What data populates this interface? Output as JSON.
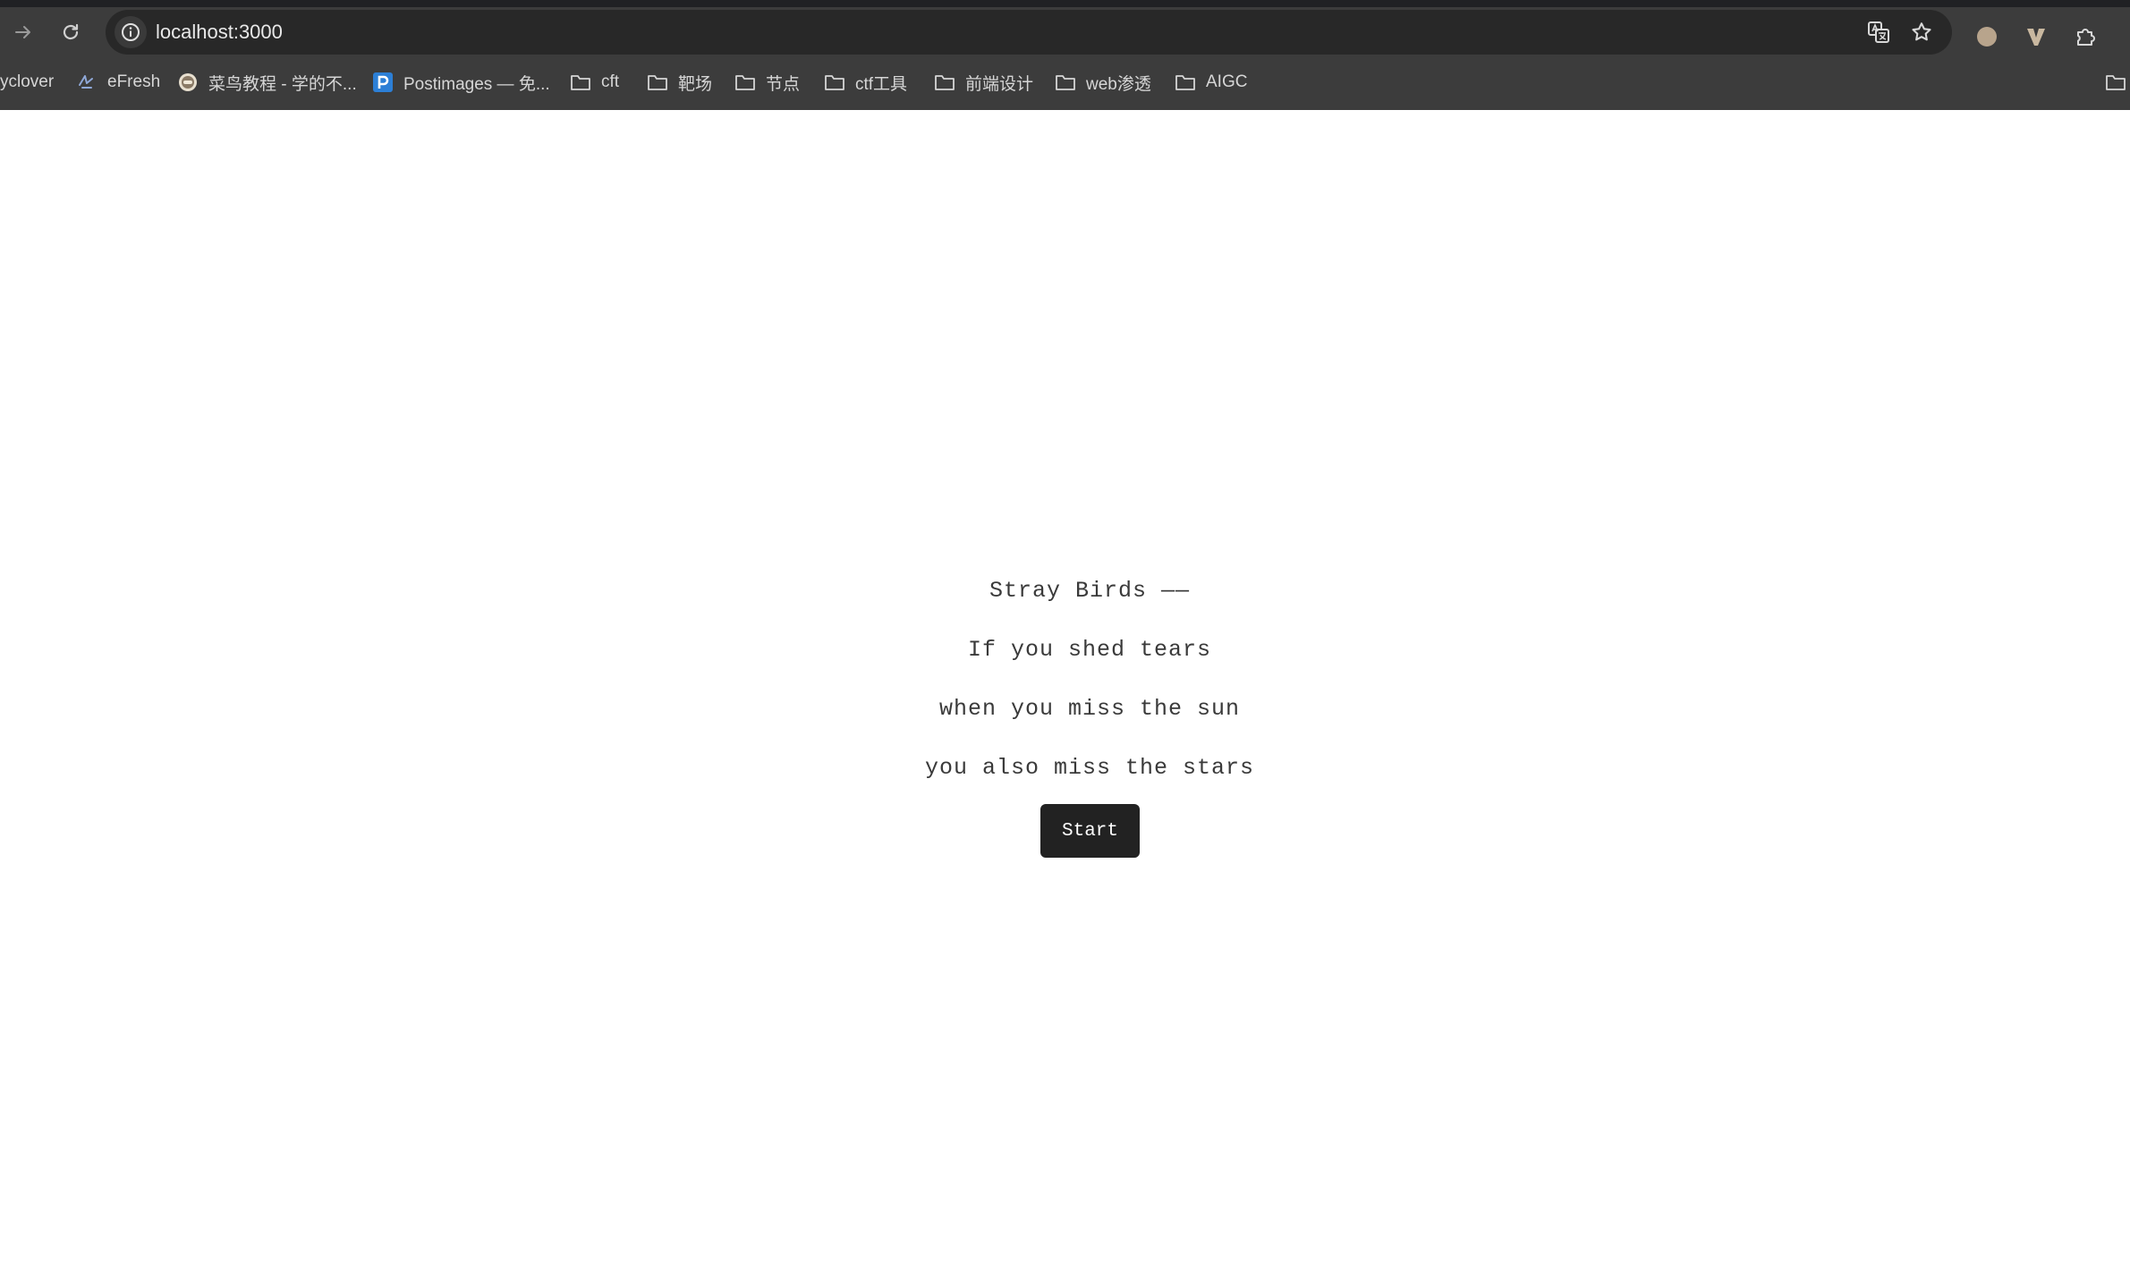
{
  "browser": {
    "url": "localhost:3000",
    "bookmarks": [
      {
        "label": "yclover",
        "icon": "none"
      },
      {
        "label": "eFresh",
        "icon": "efresh-icon"
      },
      {
        "label": "菜鸟教程 - 学的不...",
        "icon": "runoob-icon"
      },
      {
        "label": "Postimages — 免...",
        "icon": "postimages-icon"
      },
      {
        "label": "cft",
        "icon": "folder-icon"
      },
      {
        "label": "靶场",
        "icon": "folder-icon"
      },
      {
        "label": "节点",
        "icon": "folder-icon"
      },
      {
        "label": "ctf工具",
        "icon": "folder-icon"
      },
      {
        "label": "前端设计",
        "icon": "folder-icon"
      },
      {
        "label": "web渗透",
        "icon": "folder-icon"
      },
      {
        "label": "AIGC",
        "icon": "folder-icon"
      }
    ]
  },
  "poem": {
    "title": "Stray Birds ——",
    "lines": [
      "If you shed tears",
      "when you miss the sun",
      "you also miss the stars"
    ]
  },
  "start_button": {
    "label": "Start"
  },
  "colors": {
    "chrome_bg": "#3c3c3c",
    "omnibox_bg": "#282828",
    "button_bg": "#222222",
    "text": "#3a3a3a"
  }
}
